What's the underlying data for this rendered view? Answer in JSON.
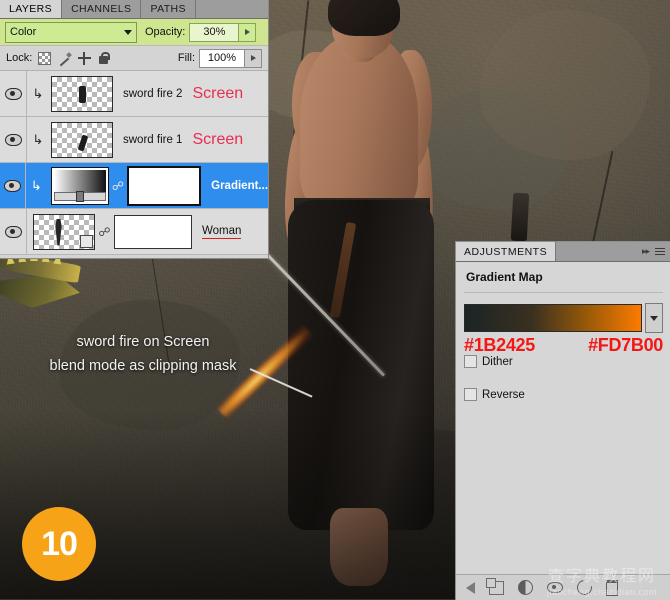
{
  "layers_panel": {
    "tabs": [
      {
        "label": "LAYERS",
        "active": true
      },
      {
        "label": "CHANNELS",
        "active": false
      },
      {
        "label": "PATHS",
        "active": false
      }
    ],
    "blend_mode": "Color",
    "opacity_label": "Opacity:",
    "opacity_value": "30%",
    "lock_label": "Lock:",
    "lock_icons": [
      "lock-transparent-pixels-icon",
      "lock-image-pixels-icon",
      "lock-position-icon",
      "lock-all-icon"
    ],
    "fill_label": "Fill:",
    "fill_value": "100%",
    "layers": [
      {
        "name": "sword fire 2",
        "blend_tag": "Screen",
        "clipped": true,
        "visible": true,
        "selected": false,
        "thumb": "checker-small-blob"
      },
      {
        "name": "sword fire 1",
        "blend_tag": "Screen",
        "clipped": true,
        "visible": true,
        "selected": false,
        "thumb": "checker-small-blob"
      },
      {
        "name": "Gradient...",
        "blend_tag": "",
        "clipped": true,
        "visible": true,
        "selected": true,
        "thumb": "gradient-map-adjustment"
      },
      {
        "name": "Woman",
        "blend_tag": "",
        "clipped": false,
        "visible": true,
        "selected": false,
        "thumb": "checker-figure",
        "name_underlined": true
      }
    ]
  },
  "adjustments_panel": {
    "tab_label": "ADJUSTMENTS",
    "collapse_icon": "double-arrow-right-icon",
    "menu_icon": "panel-menu-icon",
    "title": "Gradient Map",
    "gradient": {
      "start_hex": "#1B2425",
      "end_hex": "#FD7B00",
      "dropdown_icon": "chevron-down-icon"
    },
    "dither": {
      "label": "Dither",
      "checked": false
    },
    "reverse": {
      "label": "Reverse",
      "checked": false
    },
    "bottom_icons": [
      "back-arrow-icon",
      "clip-to-layer-icon",
      "new-adjustment-layer-icon",
      "toggle-visibility-eye-icon",
      "reset-icon",
      "delete-icon"
    ]
  },
  "annotation": {
    "line1": "sword fire on Screen",
    "line2": "blend mode as clipping mask",
    "step_number": "10",
    "accent_color": "#f6a318"
  },
  "watermark": {
    "chinese": "查字典教程网",
    "english": "jiaocheng.chazidian.com"
  },
  "canvas": {
    "description": "woman-with-sword-photo"
  }
}
